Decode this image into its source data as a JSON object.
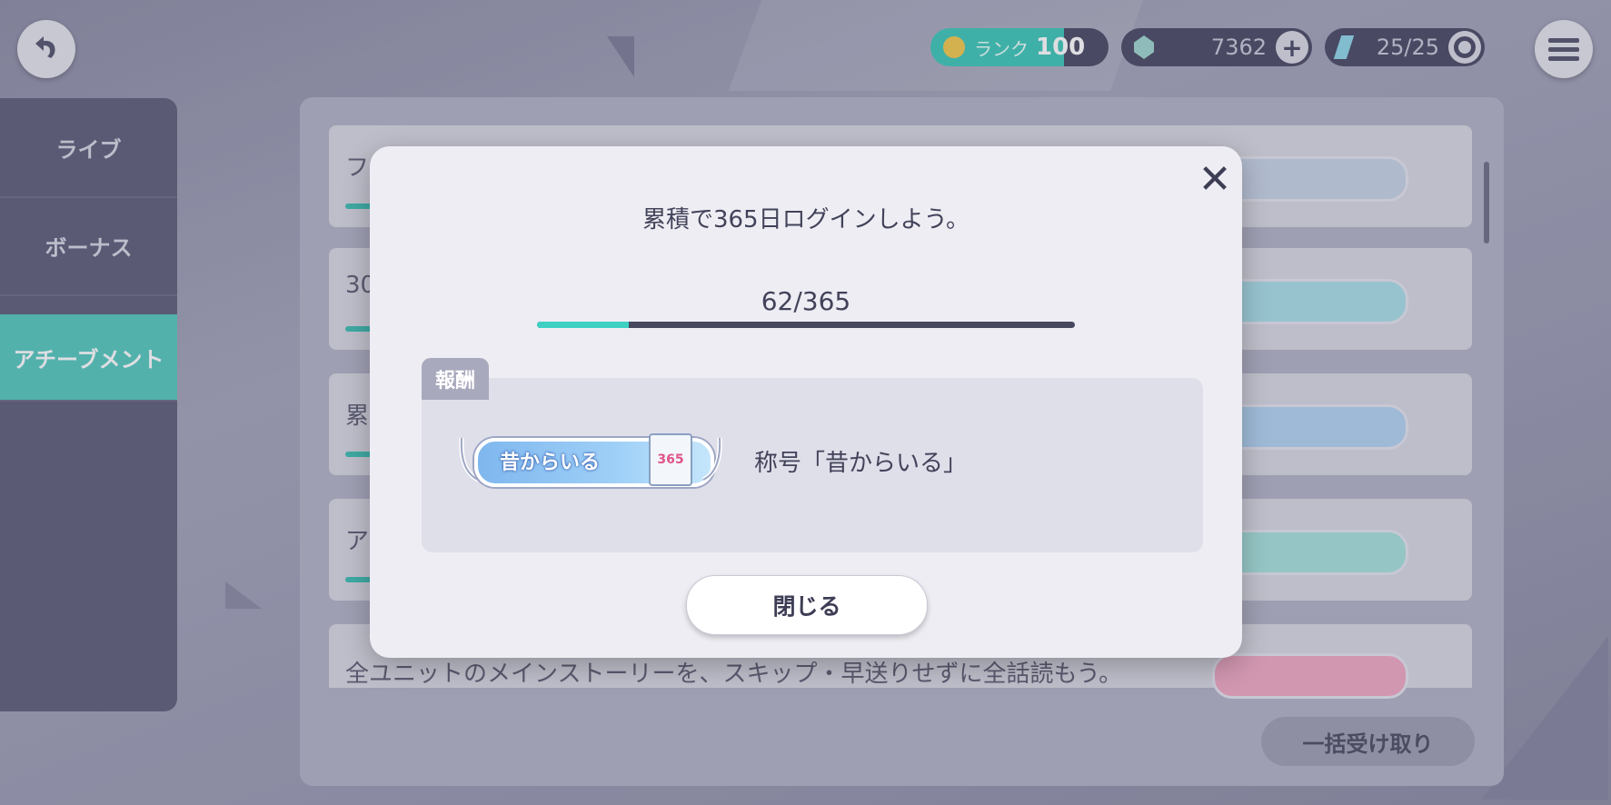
{
  "hud": {
    "rank_label": "ランク",
    "rank_value": "100",
    "crystals": "7362",
    "energy": "25/25"
  },
  "sidebar": {
    "items": [
      {
        "label": "ライブ"
      },
      {
        "label": "ボーナス"
      },
      {
        "label": "アチーブメント"
      }
    ]
  },
  "list": {
    "rows": [
      {
        "text": "フ"
      },
      {
        "text": "30"
      },
      {
        "text": "累"
      },
      {
        "text": "ア"
      },
      {
        "text": "全ユニットのメインストーリーを、スキップ・早送りせずに全話読もう。"
      }
    ],
    "claim_all_label": "一括受け取り"
  },
  "modal": {
    "description": "累積で365日ログインしよう。",
    "progress_text": "62/365",
    "progress_fraction": 0.17,
    "reward_tag": "報酬",
    "badge_label": "昔からいる",
    "badge_calendar": "365",
    "reward_name": "称号「昔からいる」",
    "close_label": "閉じる"
  },
  "colors": {
    "accent": "#3fd0c4",
    "modal_bg": "#ededf3"
  }
}
